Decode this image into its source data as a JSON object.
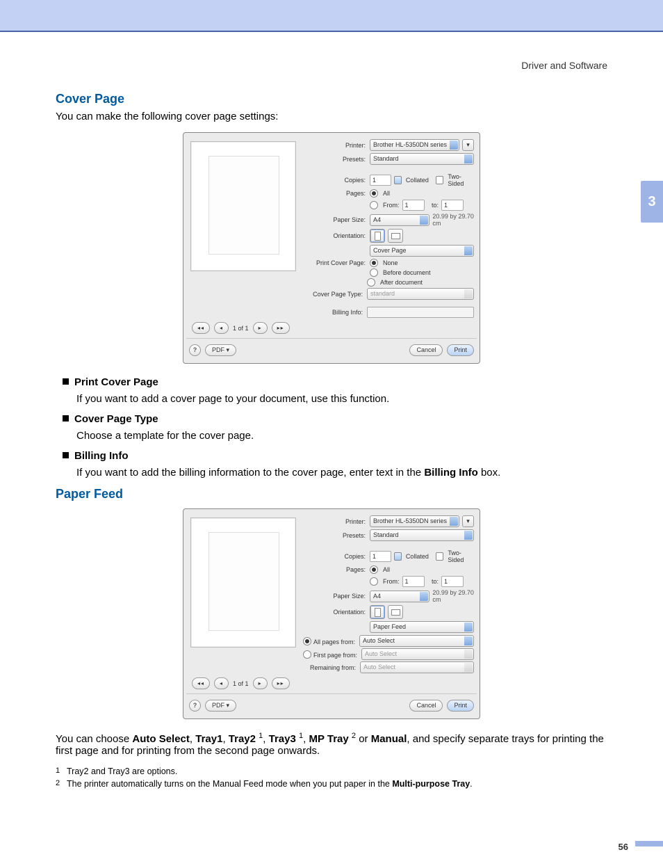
{
  "header": {
    "section": "Driver and Software"
  },
  "chapter": "3",
  "page_number": "56",
  "cover_page": {
    "heading": "Cover Page",
    "lead": "You can make the following cover page settings:",
    "items": [
      {
        "title": "Print Cover Page",
        "desc_pre": "If you want to add a cover page to your document, use this function.",
        "bold": "",
        "desc_post": ""
      },
      {
        "title": "Cover Page Type",
        "desc_pre": "Choose a template for the cover page.",
        "bold": "",
        "desc_post": ""
      },
      {
        "title": "Billing Info",
        "desc_pre": "If you want to add the billing information to the cover page, enter text in the ",
        "bold": "Billing Info",
        "desc_post": " box."
      }
    ]
  },
  "paper_feed": {
    "heading": "Paper Feed",
    "desc_pre": "You can choose ",
    "opt1": "Auto Select",
    "sep": ", ",
    "opt2": "Tray1",
    "opt3": "Tray2",
    "fn1": "1",
    "opt4": "Tray3",
    "opt5": "MP Tray",
    "fn2": "2",
    "or": " or ",
    "opt6": "Manual",
    "desc_post": ", and specify separate trays for printing the first page and for printing from the second page onwards.",
    "footnotes": [
      {
        "ref": "1",
        "text_pre": "Tray2 and Tray3 are options.",
        "bold": "",
        "text_post": ""
      },
      {
        "ref": "2",
        "text_pre": "The printer automatically turns on the Manual Feed mode when you put paper in the ",
        "bold": "Multi-purpose Tray",
        "text_post": "."
      }
    ]
  },
  "dialog": {
    "printer_lbl": "Printer:",
    "printer": "Brother HL-5350DN series",
    "presets_lbl": "Presets:",
    "presets": "Standard",
    "copies_lbl": "Copies:",
    "copies": "1",
    "collated": "Collated",
    "twosided": "Two-Sided",
    "pages_lbl": "Pages:",
    "all": "All",
    "from": "From:",
    "from_v": "1",
    "to": "to:",
    "to_v": "1",
    "papersize_lbl": "Paper Size:",
    "papersize": "A4",
    "dims": "20.99 by 29.70 cm",
    "orient_lbl": "Orientation:",
    "section1": "Cover Page",
    "pcp_lbl": "Print Cover Page:",
    "pcp_none": "None",
    "pcp_before": "Before document",
    "pcp_after": "After document",
    "cpt_lbl": "Cover Page Type:",
    "cpt_val": "standard",
    "bi_lbl": "Billing Info:",
    "section2": "Paper Feed",
    "apf_lbl": "All pages from:",
    "apf_val": "Auto Select",
    "fpf_lbl": "First page from:",
    "fpf_val": "Auto Select",
    "rpf_lbl": "Remaining from:",
    "rpf_val": "Auto Select",
    "nav_count": "1 of 1",
    "pdf": "PDF ▾",
    "help": "?",
    "cancel": "Cancel",
    "print": "Print"
  }
}
